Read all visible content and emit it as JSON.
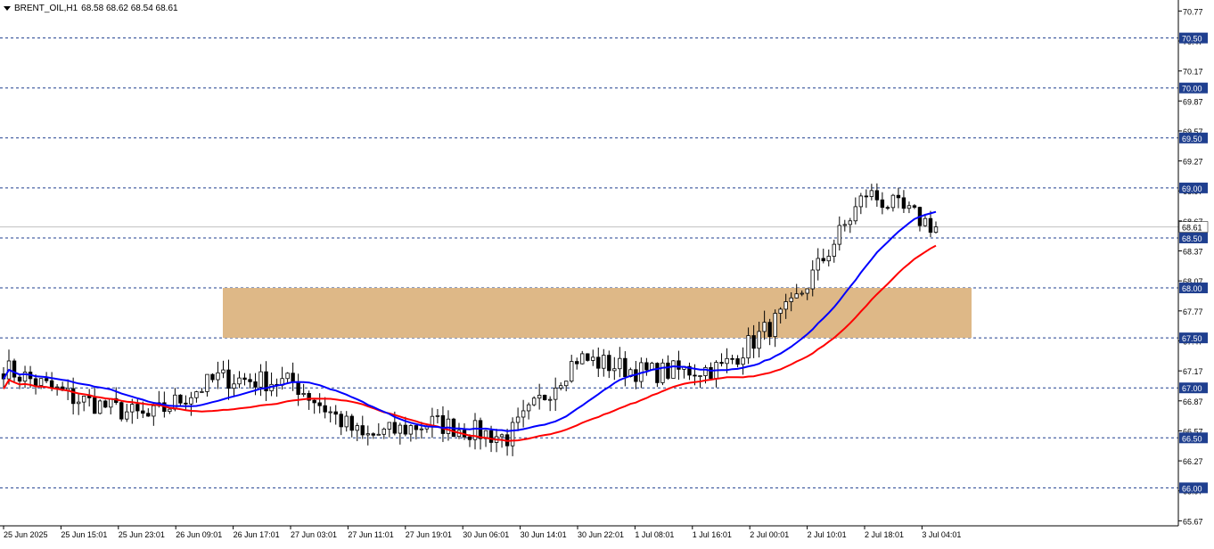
{
  "header": {
    "symbol": "BRENT_OIL,H1",
    "ohlc": "68.58 68.62 68.54 68.61"
  },
  "price_axis": {
    "ticks": [
      "70.77",
      "70.47",
      "70.17",
      "69.87",
      "69.57",
      "69.27",
      "68.97",
      "68.67",
      "68.37",
      "68.07",
      "67.77",
      "67.47",
      "67.17",
      "66.87",
      "66.57",
      "66.27",
      "65.97",
      "65.67"
    ],
    "current_price": "68.61",
    "level_labels": [
      "70.50",
      "70.00",
      "69.50",
      "69.00",
      "68.50",
      "68.00",
      "67.50",
      "67.00",
      "66.50",
      "66.00"
    ]
  },
  "time_axis": {
    "labels": [
      "25 Jun 2025",
      "25 Jun 15:01",
      "25 Jun 23:01",
      "26 Jun 09:01",
      "26 Jun 17:01",
      "27 Jun 03:01",
      "27 Jun 11:01",
      "27 Jun 19:01",
      "30 Jun 06:01",
      "30 Jun 14:01",
      "30 Jun 22:01",
      "1 Jul 08:01",
      "1 Jul 16:01",
      "2 Jul 00:01",
      "2 Jul 10:01",
      "2 Jul 18:01",
      "3 Jul 04:01"
    ]
  },
  "colors": {
    "bull_body": "#ffffff",
    "bear_body": "#000000",
    "wick": "#000000",
    "ma_fast": "#0000ff",
    "ma_slow": "#ff0000",
    "level_line": "#1f3f8f",
    "level_label_bg": "#1f3f8f",
    "zone": "#deb887",
    "current_line": "#c0c0c0"
  },
  "zone": {
    "low": 67.5,
    "high": 68.0
  },
  "chart_data": {
    "type": "candlestick",
    "symbol": "BRENT_OIL",
    "timeframe": "H1",
    "ylim": [
      65.62,
      70.88
    ],
    "levels": [
      70.5,
      70.0,
      69.5,
      69.0,
      68.5,
      68.0,
      67.5,
      67.0,
      66.5,
      66.0
    ],
    "key_points": [
      {
        "time": "25 Jun 2025",
        "close": 67.2
      },
      {
        "time": "25 Jun 15:01",
        "close": 66.9
      },
      {
        "time": "26 Jun 09:01",
        "close": 66.7
      },
      {
        "time": "26 Jun 17:01",
        "close": 67.1
      },
      {
        "time": "27 Jun 11:01",
        "close": 67.05
      },
      {
        "time": "27 Jun 19:01",
        "close": 66.5
      },
      {
        "time": "30 Jun 06:01",
        "close": 66.65
      },
      {
        "time": "30 Jun 22:01",
        "close": 66.5
      },
      {
        "time": "1 Jul 08:01",
        "close": 67.3
      },
      {
        "time": "1 Jul 16:01",
        "close": 67.15
      },
      {
        "time": "2 Jul 00:01",
        "close": 67.2
      },
      {
        "time": "2 Jul 10:01",
        "close": 67.8
      },
      {
        "time": "2 Jul 18:01",
        "close": 68.95
      },
      {
        "time": "3 Jul 04:01",
        "close": 68.61
      }
    ]
  }
}
